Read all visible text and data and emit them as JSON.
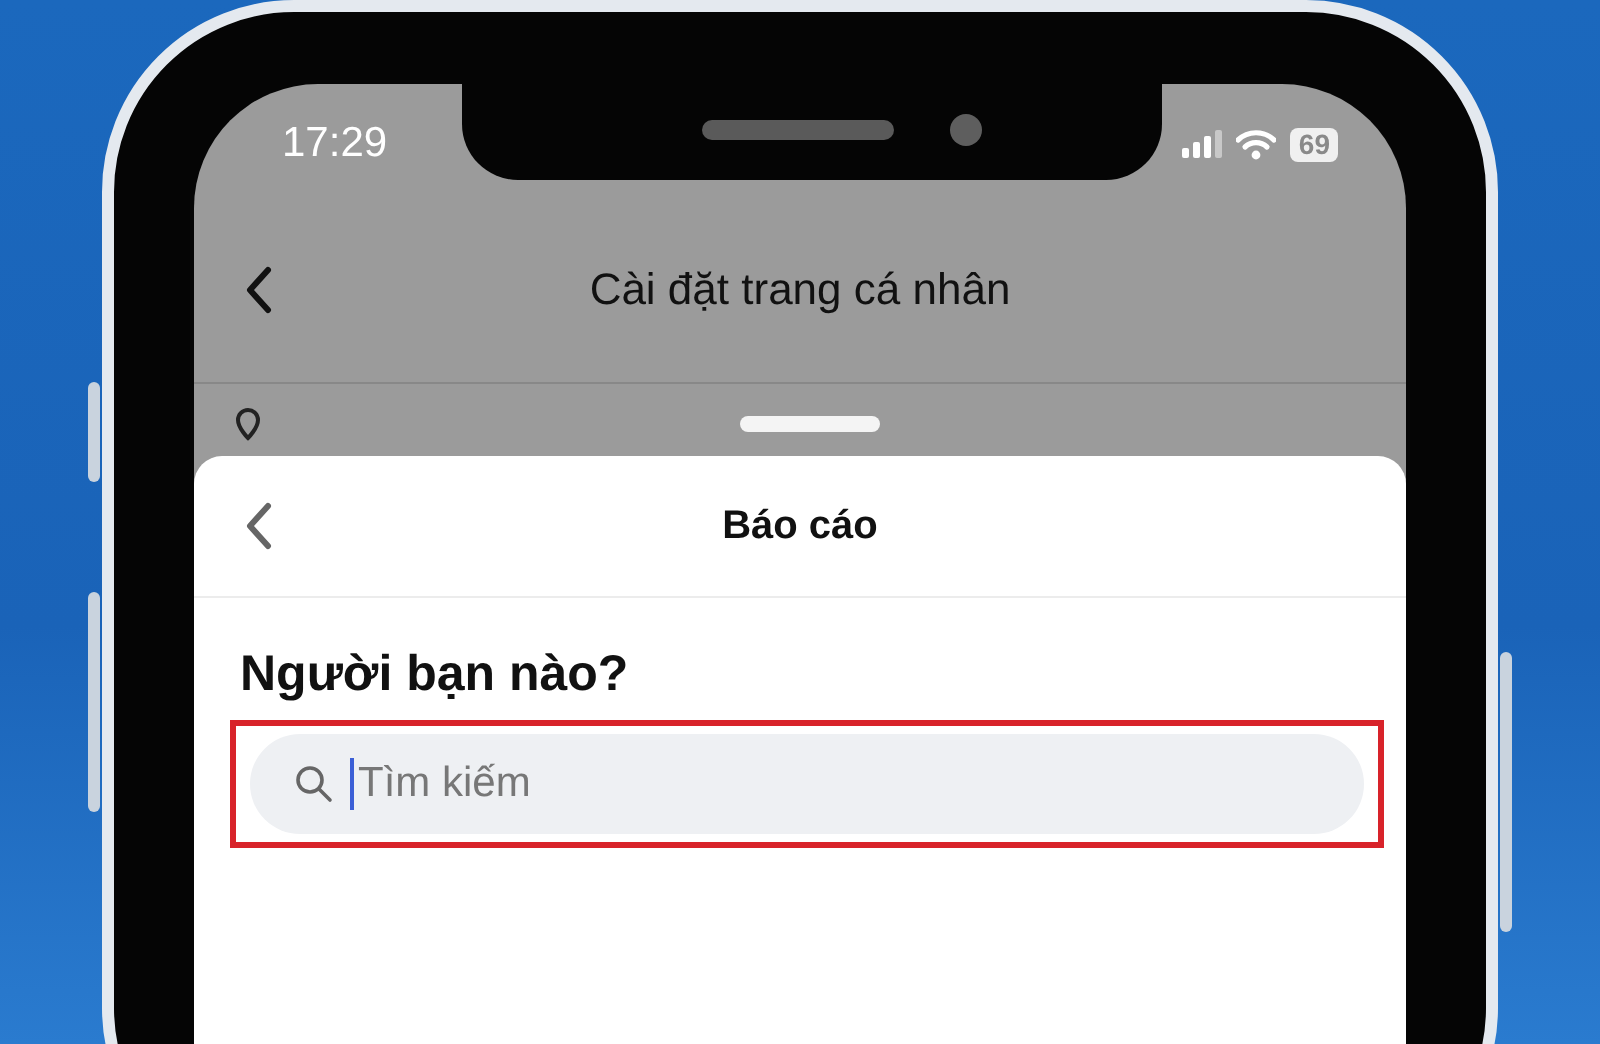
{
  "status_bar": {
    "time": "17:29",
    "battery": "69"
  },
  "header": {
    "title": "Cài đặt trang cá nhân"
  },
  "sheet": {
    "title": "Báo cáo",
    "heading": "Người bạn nào?"
  },
  "search": {
    "placeholder": "Tìm kiếm",
    "focused": true,
    "highlighted": true
  }
}
